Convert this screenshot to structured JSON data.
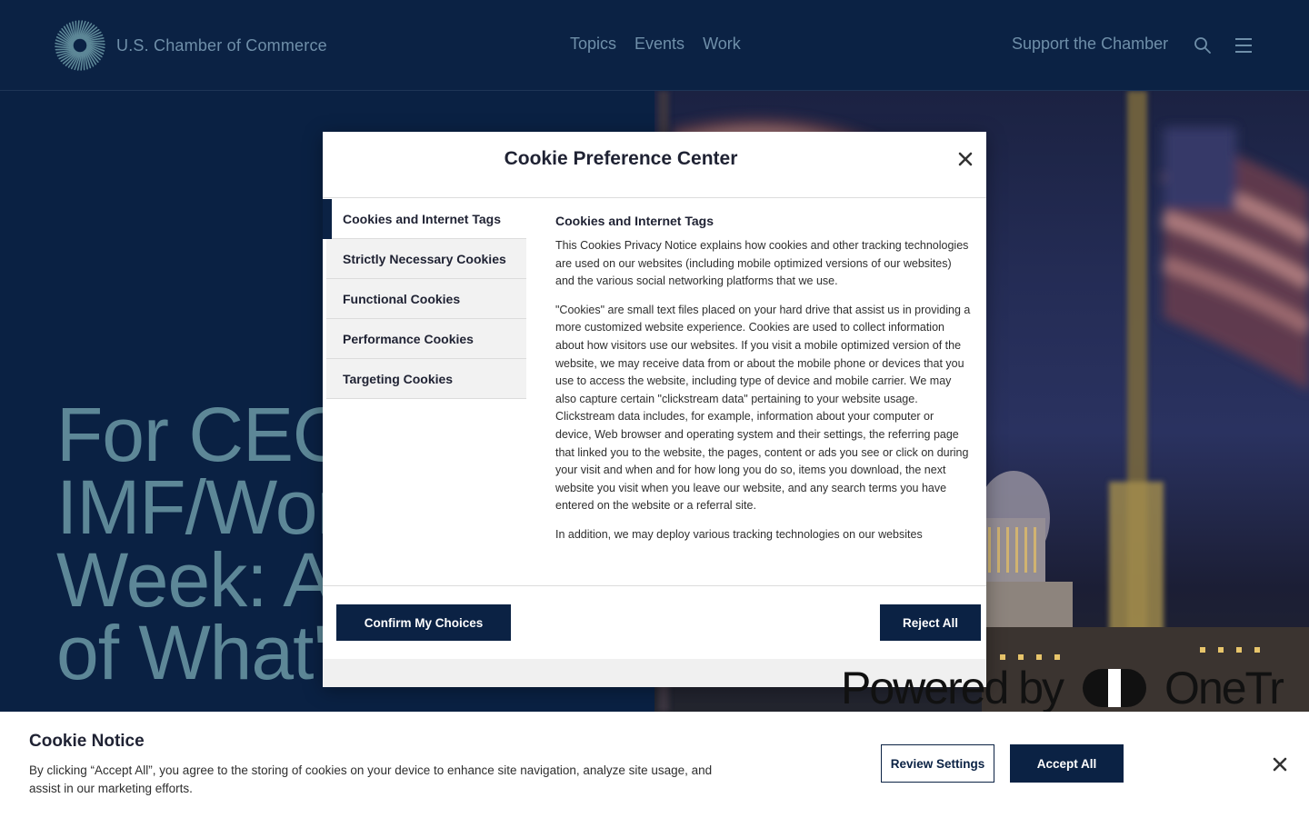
{
  "header": {
    "brand_name": "U.S. Chamber of Commerce",
    "nav": [
      "Topics",
      "Events",
      "Work"
    ],
    "support_link": "Support the Chamber",
    "search_icon": "search-icon",
    "menu_icon": "hamburger-menu-icon"
  },
  "hero": {
    "title_lines": [
      "For CEO",
      "IMF/Wor",
      "Week: A",
      "of What's"
    ]
  },
  "modal": {
    "title": "Cookie Preference Center",
    "close_icon": "close-icon",
    "tabs": [
      "Cookies and Internet Tags",
      "Strictly Necessary Cookies",
      "Functional Cookies",
      "Performance Cookies",
      "Targeting Cookies"
    ],
    "active_tab": 0,
    "content": {
      "heading": "Cookies and Internet Tags",
      "paragraphs": [
        "This Cookies Privacy Notice explains how cookies and other tracking technologies are used on our websites (including mobile optimized versions of our websites) and the various social networking platforms that we use.",
        "\"Cookies\" are small text files placed on your hard drive that assist us in providing a more customized website experience. Cookies are used to collect information about how visitors use our websites. If you visit a mobile optimized version of the website, we may receive data from or about the mobile phone or devices that you use to access the website, including type of device and mobile carrier. We may also capture certain \"clickstream data\" pertaining to your website usage. Clickstream data includes, for example, information about your computer or device, Web browser and operating system and their settings, the referring page that linked you to the website, the pages, content or ads you see or click on during your visit and when and for how long you do so, items you download, the next website you visit when you leave our website, and any search terms you have entered on the website or a referral site.",
        "In addition, we may deploy various tracking technologies on our websites"
      ]
    },
    "confirm_label": "Confirm My Choices",
    "reject_label": "Reject All",
    "powered_prefix": "Powered by",
    "powered_suffix": "OneTr"
  },
  "cookie_notice": {
    "title": "Cookie Notice",
    "text": "By clicking “Accept All”, you agree to the storing of cookies on your device to enhance site navigation, analyze site usage, and assist in our marketing efforts.",
    "review_label": "Review Settings",
    "accept_label": "Accept All",
    "close_icon": "close-icon"
  },
  "colors": {
    "navy": "#0b2244",
    "nav_text": "#6f8fa9",
    "hero_text": "#5d8797"
  }
}
